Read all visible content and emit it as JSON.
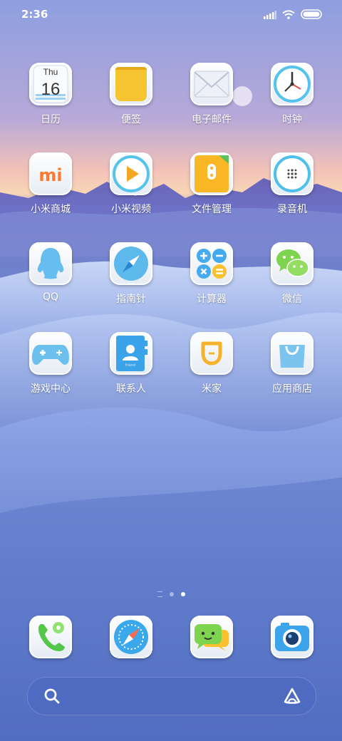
{
  "status_bar": {
    "time": "2:36"
  },
  "apps": [
    {
      "label": "日历",
      "icon": "calendar-icon",
      "day": "Thu",
      "date": "16"
    },
    {
      "label": "便签",
      "icon": "notes-icon"
    },
    {
      "label": "电子邮件",
      "icon": "email-icon"
    },
    {
      "label": "时钟",
      "icon": "clock-icon"
    },
    {
      "label": "小米商城",
      "icon": "mi-store-icon",
      "logo": "mi"
    },
    {
      "label": "小米视频",
      "icon": "video-icon"
    },
    {
      "label": "文件管理",
      "icon": "file-manager-icon"
    },
    {
      "label": "录音机",
      "icon": "recorder-icon"
    },
    {
      "label": "QQ",
      "icon": "qq-icon"
    },
    {
      "label": "指南针",
      "icon": "compass-icon"
    },
    {
      "label": "计算器",
      "icon": "calculator-icon"
    },
    {
      "label": "微信",
      "icon": "wechat-icon"
    },
    {
      "label": "游戏中心",
      "icon": "game-center-icon"
    },
    {
      "label": "联系人",
      "icon": "contacts-icon",
      "book_text": "friend"
    },
    {
      "label": "米家",
      "icon": "mijia-icon"
    },
    {
      "label": "应用商店",
      "icon": "app-store-icon"
    }
  ],
  "dock": [
    {
      "name": "phone",
      "icon": "phone-icon"
    },
    {
      "name": "browser",
      "icon": "browser-icon"
    },
    {
      "name": "messages",
      "icon": "messages-icon"
    },
    {
      "name": "camera",
      "icon": "camera-icon"
    }
  ],
  "page_indicator": {
    "pages": 2,
    "current": 2
  },
  "search_bar": {
    "left_icon": "search-icon",
    "right_icon": "assistant-icon"
  },
  "colors": {
    "accent": "#2a9df4",
    "calendar_text": "#333333"
  }
}
